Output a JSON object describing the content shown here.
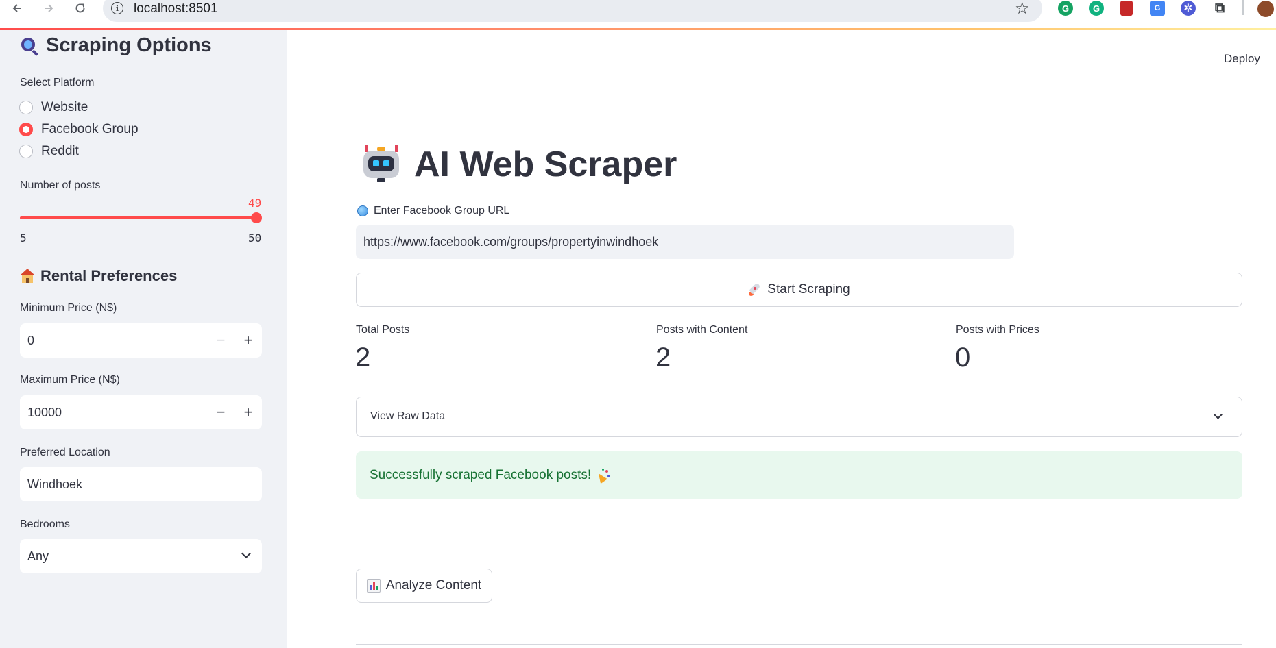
{
  "browser": {
    "url": "localhost:8501"
  },
  "sidebar": {
    "title": "Scraping Options",
    "platform_label": "Select Platform",
    "platforms": [
      {
        "label": "Website",
        "selected": false
      },
      {
        "label": "Facebook Group",
        "selected": true
      },
      {
        "label": "Reddit",
        "selected": false
      }
    ],
    "posts_label": "Number of posts",
    "posts_value": "49",
    "posts_min": "5",
    "posts_max": "50",
    "rental_heading": "Rental Preferences",
    "min_price_label": "Minimum Price (N$)",
    "min_price_value": "0",
    "max_price_label": "Maximum Price (N$)",
    "max_price_value": "10000",
    "location_label": "Preferred Location",
    "location_value": "Windhoek",
    "bedrooms_label": "Bedrooms",
    "bedrooms_value": "Any",
    "stepper_minus": "−",
    "stepper_plus": "+"
  },
  "header": {
    "deploy_label": "Deploy"
  },
  "main": {
    "title": "AI Web Scraper",
    "url_label": "Enter Facebook Group URL",
    "url_value": "https://www.facebook.com/groups/propertyinwindhoek",
    "start_button": "Start Scraping",
    "metrics": [
      {
        "label": "Total Posts",
        "value": "2"
      },
      {
        "label": "Posts with Content",
        "value": "2"
      },
      {
        "label": "Posts with Prices",
        "value": "0"
      }
    ],
    "expander_label": "View Raw Data",
    "success_message": "Successfully scraped Facebook posts!",
    "analyze_button": "Analyze Content"
  },
  "colors": {
    "accent": "#ff4b4b",
    "sidebar_bg": "#f0f2f6",
    "success_bg": "#e8f8ee",
    "success_text": "#177233",
    "text": "#31333f"
  }
}
